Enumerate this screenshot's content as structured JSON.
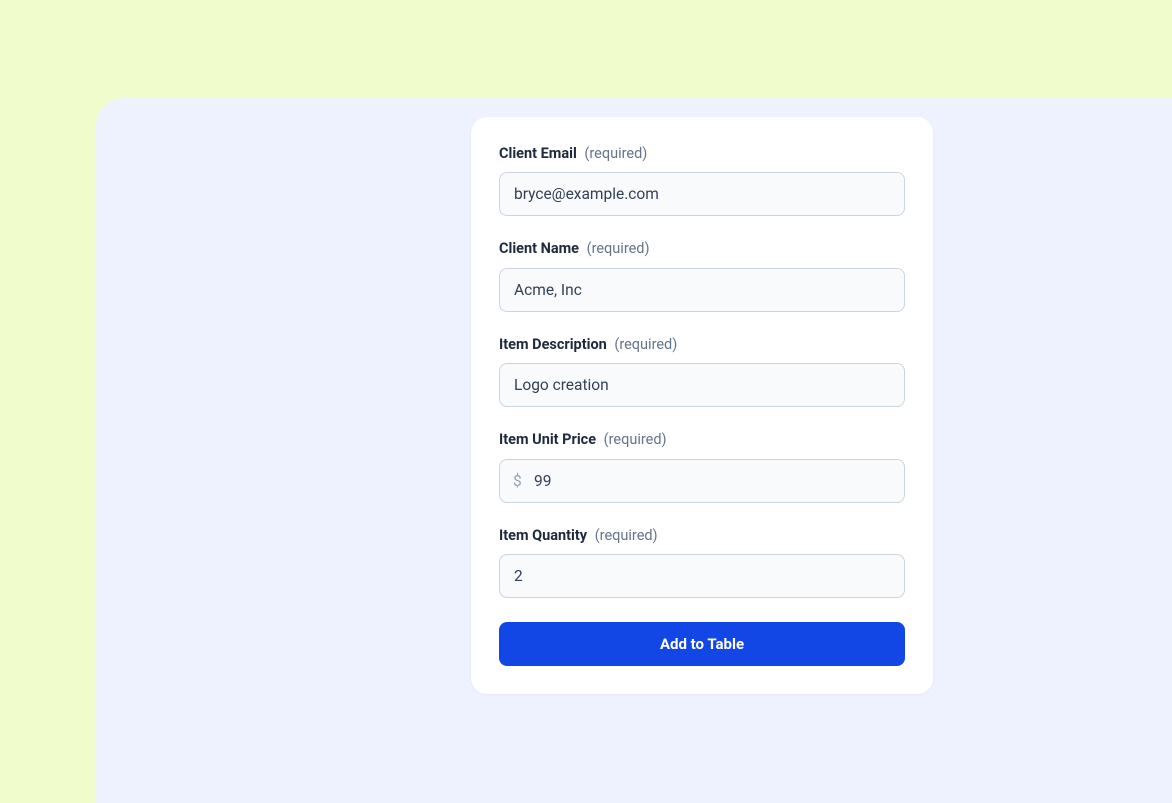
{
  "form": {
    "required_text": "(required)",
    "fields": {
      "client_email": {
        "label": "Client Email",
        "value": "bryce@example.com"
      },
      "client_name": {
        "label": "Client Name",
        "value": "Acme, Inc"
      },
      "item_description": {
        "label": "Item Description",
        "value": "Logo creation"
      },
      "item_unit_price": {
        "label": "Item Unit Price",
        "prefix": "$",
        "value": "99"
      },
      "item_quantity": {
        "label": "Item Quantity",
        "value": "2"
      }
    },
    "submit_label": "Add to Table"
  }
}
